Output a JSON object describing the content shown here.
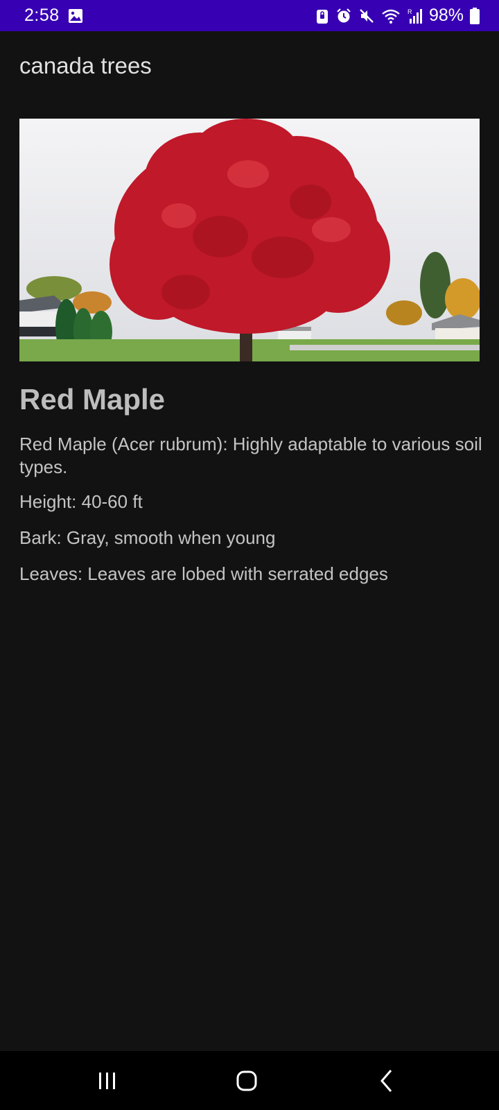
{
  "status_bar": {
    "time": "2:58",
    "battery": "98%",
    "icons": [
      "gallery-icon",
      "lock-icon",
      "alarm-icon",
      "mute-icon",
      "wifi-icon",
      "signal-icon",
      "battery-icon"
    ],
    "background": "#3700b3"
  },
  "app_bar": {
    "title": "canada trees"
  },
  "tree": {
    "name": "Red Maple",
    "description": "Red Maple (Acer rubrum): Highly adaptable to various soil types.",
    "height": "Height: 40-60 ft",
    "bark": "Bark: Gray, smooth when young",
    "leaves": "Leaves: Leaves are lobed with serrated edges"
  },
  "nav_bar": {
    "icons": [
      "recents-icon",
      "home-icon",
      "back-icon"
    ]
  }
}
